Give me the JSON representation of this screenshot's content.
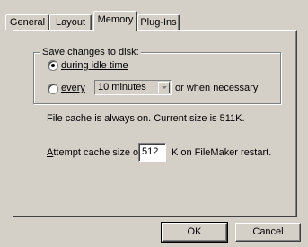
{
  "tabs": [
    "General",
    "Layout",
    "Memory",
    "Plug-Ins"
  ],
  "active_tab": "Memory",
  "save_group": {
    "label": "Save changes to disk:",
    "option_idle": "during idle time",
    "option_every": "every",
    "interval_value": "10 minutes",
    "interval_suffix": "or when necessary",
    "selected_option": "during idle time"
  },
  "cache_info": "File cache is always on.  Current size is 511K.",
  "cache_attempt": {
    "prefix": "Attempt cache size of",
    "value": "512",
    "suffix": "K on FileMaker restart."
  },
  "buttons": {
    "ok": "OK",
    "cancel": "Cancel"
  }
}
